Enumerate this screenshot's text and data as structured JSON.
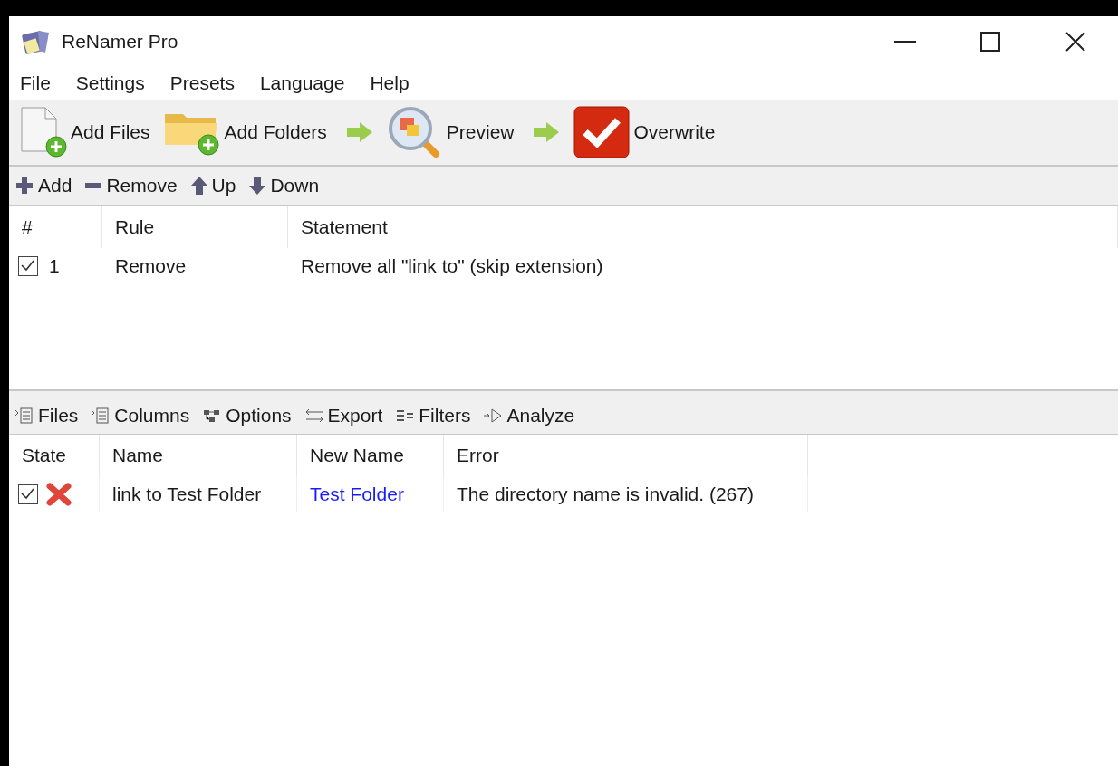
{
  "window": {
    "title": "ReNamer Pro"
  },
  "menu": [
    "File",
    "Settings",
    "Presets",
    "Language",
    "Help"
  ],
  "toolbar": [
    {
      "kind": "add-files",
      "label": "Add Files"
    },
    {
      "kind": "add-folders",
      "label": "Add Folders"
    },
    {
      "kind": "arrow"
    },
    {
      "kind": "preview",
      "label": "Preview"
    },
    {
      "kind": "arrow"
    },
    {
      "kind": "overwrite",
      "label": "Overwrite"
    }
  ],
  "rules_toolbar": [
    {
      "kind": "plus",
      "label": "Add"
    },
    {
      "kind": "minus",
      "label": "Remove"
    },
    {
      "kind": "up",
      "label": "Up"
    },
    {
      "kind": "down",
      "label": "Down"
    }
  ],
  "rules_table": {
    "columns": [
      "#",
      "Rule",
      "Statement"
    ],
    "rows": [
      {
        "checked": true,
        "number": "1",
        "rule": "Remove",
        "statement": "Remove all \"link to\" (skip extension)"
      }
    ]
  },
  "files_toolbar": [
    {
      "kind": "list",
      "label": "Files"
    },
    {
      "kind": "list",
      "label": "Columns"
    },
    {
      "kind": "options",
      "label": "Options"
    },
    {
      "kind": "export",
      "label": "Export"
    },
    {
      "kind": "filters",
      "label": "Filters"
    },
    {
      "kind": "analyze",
      "label": "Analyze"
    }
  ],
  "files_table": {
    "columns": [
      "State",
      "Name",
      "New Name",
      "Error"
    ],
    "rows": [
      {
        "checked": true,
        "kind": "error",
        "name": "link to Test Folder",
        "new_name": "Test Folder",
        "error": "The directory name is invalid. (267)"
      }
    ]
  }
}
